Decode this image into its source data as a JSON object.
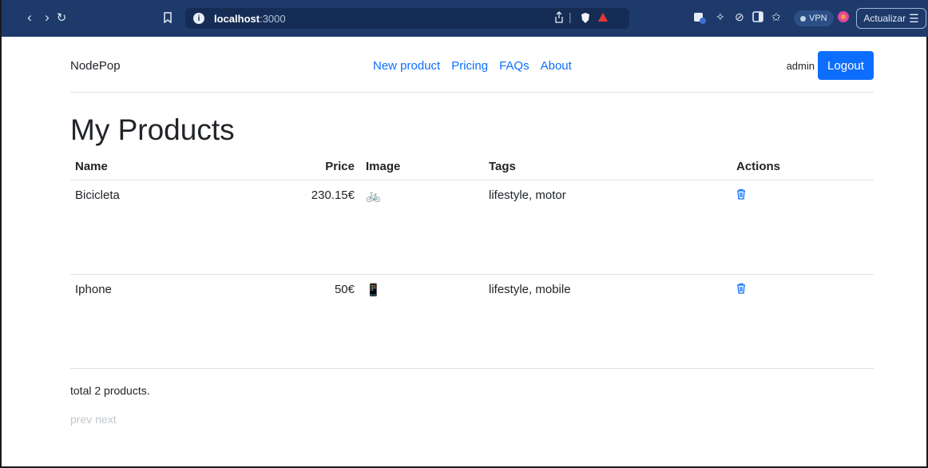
{
  "browser": {
    "back_icon": "chevron-left-icon",
    "forward_icon": "chevron-right-icon",
    "reload_icon": "reload-icon",
    "bookmark_icon": "bookmark-icon",
    "url_host": "localhost",
    "url_port": ":3000",
    "vpn_label": "VPN",
    "update_label": "Actualizar"
  },
  "header": {
    "brand": "NodePop",
    "nav": [
      "New product",
      "Pricing",
      "FAQs",
      "About"
    ],
    "username": "admin",
    "logout_label": "Logout"
  },
  "main": {
    "title": "My Products",
    "columns": {
      "name": "Name",
      "price": "Price",
      "image": "Image",
      "tags": "Tags",
      "actions": "Actions"
    },
    "rows": [
      {
        "name": "Bicicleta",
        "price": "230.15€",
        "image": "🚲",
        "tags": "lifestyle, motor",
        "action_icon": "trash-icon"
      },
      {
        "name": "Iphone",
        "price": "50€",
        "image": "📱",
        "tags": "lifestyle, mobile",
        "action_icon": "trash-icon"
      }
    ],
    "total": "total 2 products.",
    "pager": {
      "prev": "prev",
      "next": "next"
    }
  },
  "colors": {
    "accent": "#0d6efd",
    "chrome_bg": "#1d3a6a"
  }
}
